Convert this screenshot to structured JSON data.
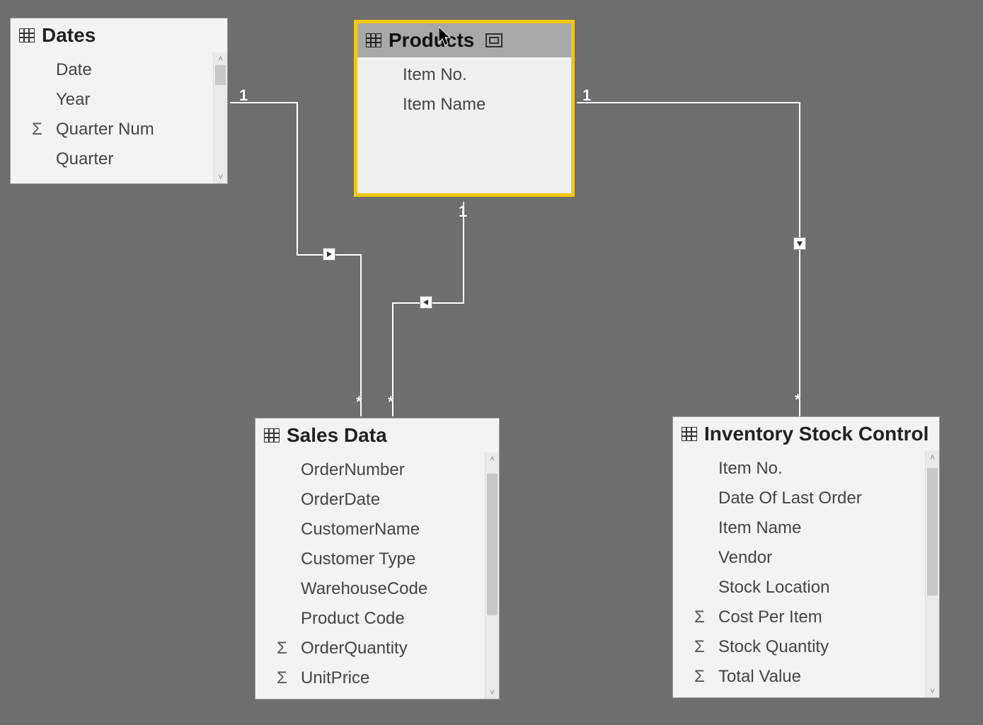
{
  "tables": {
    "dates": {
      "title": "Dates",
      "fields": [
        {
          "label": "Date",
          "sigma": false
        },
        {
          "label": "Year",
          "sigma": false
        },
        {
          "label": "Quarter Num",
          "sigma": true
        },
        {
          "label": "Quarter",
          "sigma": false
        }
      ]
    },
    "products": {
      "title": "Products",
      "fields": [
        {
          "label": "Item No.",
          "sigma": false
        },
        {
          "label": "Item Name",
          "sigma": false
        }
      ]
    },
    "sales": {
      "title": "Sales Data",
      "fields": [
        {
          "label": "OrderNumber",
          "sigma": false
        },
        {
          "label": "OrderDate",
          "sigma": false
        },
        {
          "label": "CustomerName",
          "sigma": false
        },
        {
          "label": "Customer Type",
          "sigma": false
        },
        {
          "label": "WarehouseCode",
          "sigma": false
        },
        {
          "label": "Product Code",
          "sigma": false
        },
        {
          "label": "OrderQuantity",
          "sigma": true
        },
        {
          "label": "UnitPrice",
          "sigma": true
        }
      ]
    },
    "inventory": {
      "title": "Inventory Stock Control",
      "fields": [
        {
          "label": "Item No.",
          "sigma": false
        },
        {
          "label": "Date Of Last Order",
          "sigma": false
        },
        {
          "label": "Item Name",
          "sigma": false
        },
        {
          "label": "Vendor",
          "sigma": false
        },
        {
          "label": "Stock Location",
          "sigma": false
        },
        {
          "label": "Cost Per Item",
          "sigma": true
        },
        {
          "label": "Stock Quantity",
          "sigma": true
        },
        {
          "label": "Total Value",
          "sigma": true
        }
      ]
    }
  },
  "cardinalities": {
    "dates_one": "1",
    "products_one_left": "1",
    "products_one_right": "1",
    "sales_many_left": "*",
    "sales_many_right": "*",
    "inventory_many": "*"
  }
}
